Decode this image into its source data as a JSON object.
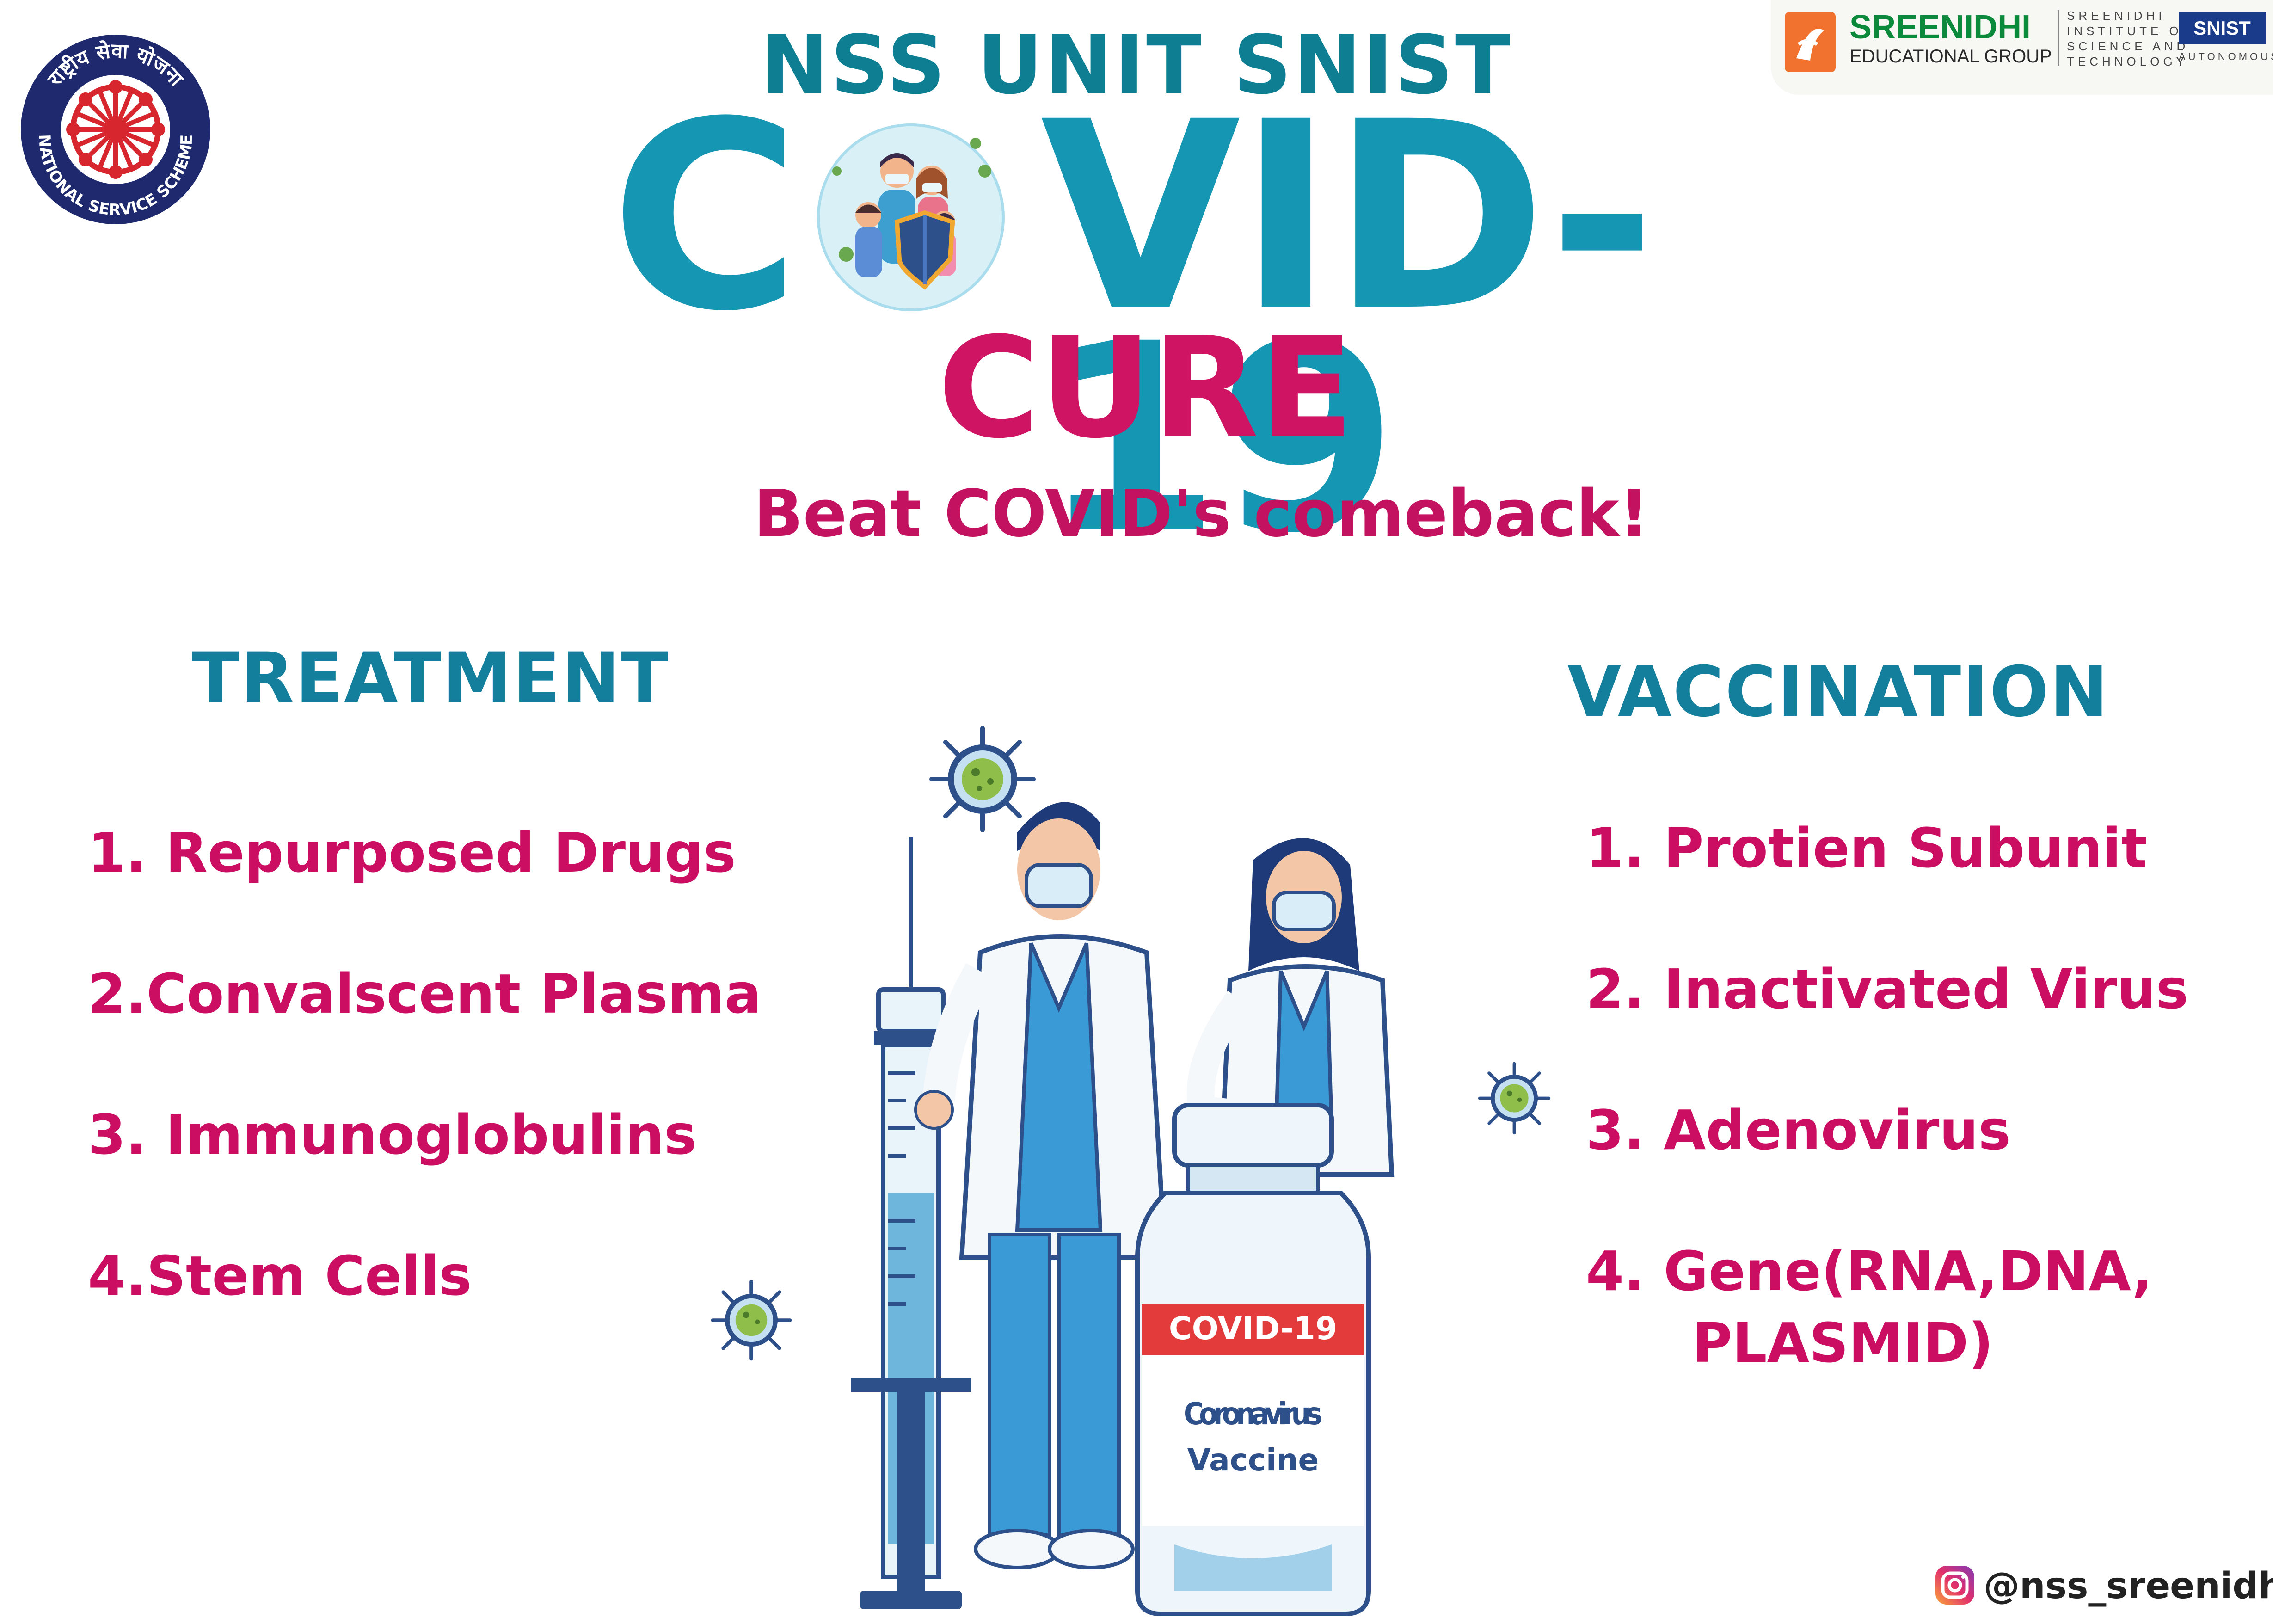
{
  "header": {
    "unit_title": "NSS UNIT SNIST",
    "covid_c": "C",
    "covid_rest": "VID-19",
    "cure": "CURE",
    "tagline": "Beat COVID's comeback!"
  },
  "nss_logo": {
    "top_text": "राष्ट्रीय सेवा योजना",
    "bottom_text": "NATIONAL SERVICE SCHEME"
  },
  "brand": {
    "name": "SREENIDHI",
    "group": "EDUCATIONAL GROUP",
    "institute_lines": [
      "SREENIDHI",
      "INSTITUTE OF",
      "SCIENCE AND",
      "TECHNOLOGY"
    ],
    "snist": "SNIST",
    "autonomous": "AUTONOMOUS"
  },
  "treatment": {
    "heading": "TREATMENT",
    "items": [
      "1. Repurposed Drugs",
      "2.Convalscent Plasma",
      "3. Immunoglobulins",
      "4.Stem Cells"
    ]
  },
  "vaccination": {
    "heading": "VACCINATION",
    "items": [
      "1. Protien Subunit",
      "2. Inactivated Virus",
      "3. Adenovirus",
      "4. Gene(RNA,DNA,",
      "PLASMID)"
    ]
  },
  "vial": {
    "label": "COVID-19",
    "line1": "Coronavirus",
    "line2": "Vaccine"
  },
  "social": {
    "icon": "instagram-icon",
    "handle": "@nss_sreenidhi"
  },
  "colors": {
    "teal": "#1596b3",
    "pink": "#cf1464"
  }
}
